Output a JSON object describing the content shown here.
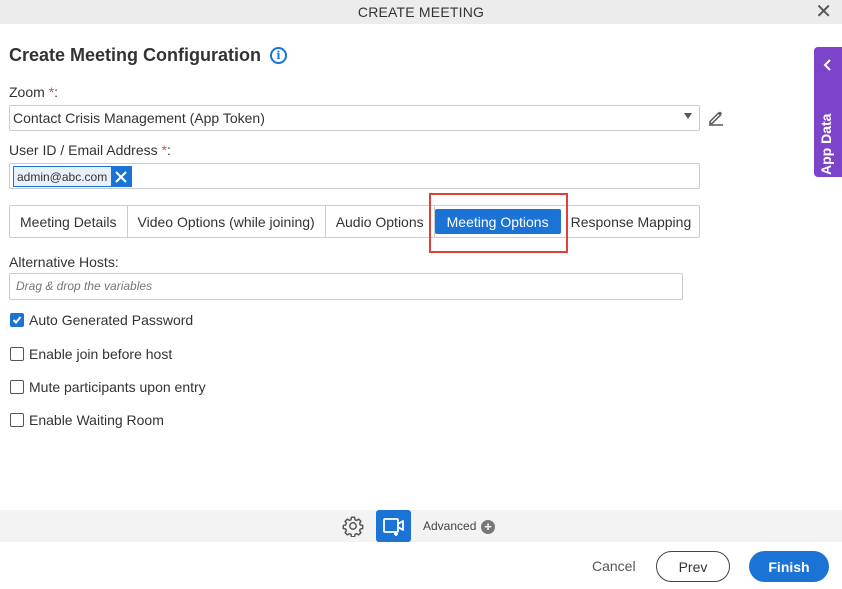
{
  "window": {
    "title": "CREATE MEETING",
    "close_icon": "close-icon"
  },
  "heading": {
    "title": "Create Meeting Configuration",
    "info_icon": "info-icon"
  },
  "zoom": {
    "label": "Zoom ",
    "required": "*",
    "colon": ":",
    "value": "Contact Crisis Management (App Token)",
    "edit_icon": "pencil-icon"
  },
  "user": {
    "label": "User ID / Email Address ",
    "required": "*",
    "colon": ":",
    "tags": [
      "admin@abc.com"
    ]
  },
  "tabs": [
    {
      "label": "Meeting Details"
    },
    {
      "label": "Video Options (while joining)"
    },
    {
      "label": "Audio Options"
    },
    {
      "label": "Meeting Options",
      "active": true
    },
    {
      "label": "Response Mapping"
    }
  ],
  "alt_hosts": {
    "label": "Alternative Hosts:",
    "placeholder": "Drag & drop the variables"
  },
  "options": [
    {
      "label": "Auto Generated Password",
      "checked": true
    },
    {
      "label": "Enable join before host",
      "checked": false
    },
    {
      "label": "Mute participants upon entry",
      "checked": false
    },
    {
      "label": "Enable Waiting Room",
      "checked": false
    }
  ],
  "side_panel": {
    "label": "App Data"
  },
  "toolbar": {
    "advanced_label": "Advanced"
  },
  "footer": {
    "cancel": "Cancel",
    "prev": "Prev",
    "finish": "Finish"
  },
  "colors": {
    "accent": "#1b73d6",
    "side_panel": "#7c44c8",
    "highlight": "#e0403a"
  }
}
